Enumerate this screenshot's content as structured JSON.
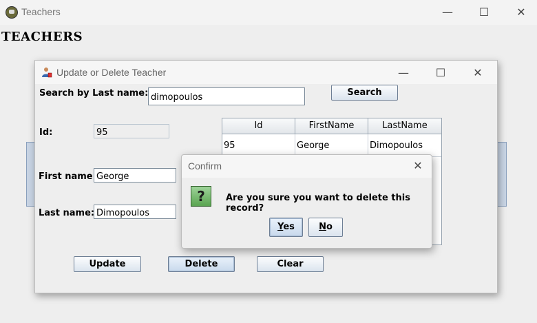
{
  "main_window": {
    "title": "Teachers",
    "heading": "TEACHERS",
    "controls": {
      "minimize": "—",
      "maximize": "☐",
      "close": "✕"
    }
  },
  "dialog": {
    "title": "Update or Delete Teacher",
    "controls": {
      "minimize": "—",
      "maximize": "☐",
      "close": "✕"
    },
    "search_label": "Search by Last name:",
    "search_value": "dimopoulos",
    "search_button": "Search",
    "id_label": "Id:",
    "id_value": "95",
    "first_name_label": "First name:",
    "first_name_value": "George",
    "last_name_label": "Last name:",
    "last_name_value": "Dimopoulos",
    "update_button": "Update",
    "delete_button": "Delete",
    "clear_button": "Clear",
    "table": {
      "columns": [
        "Id",
        "FirstName",
        "LastName"
      ],
      "rows": [
        [
          "95",
          "George",
          "Dimopoulos"
        ]
      ]
    }
  },
  "confirm": {
    "title": "Confirm",
    "close": "✕",
    "icon_glyph": "?",
    "message": "Are you sure you want to delete this record?",
    "yes_button": "Yes",
    "no_button": "No"
  },
  "icons": {
    "app": "app-logo-icon",
    "teacher": "teacher-person-icon",
    "question": "question-icon"
  }
}
